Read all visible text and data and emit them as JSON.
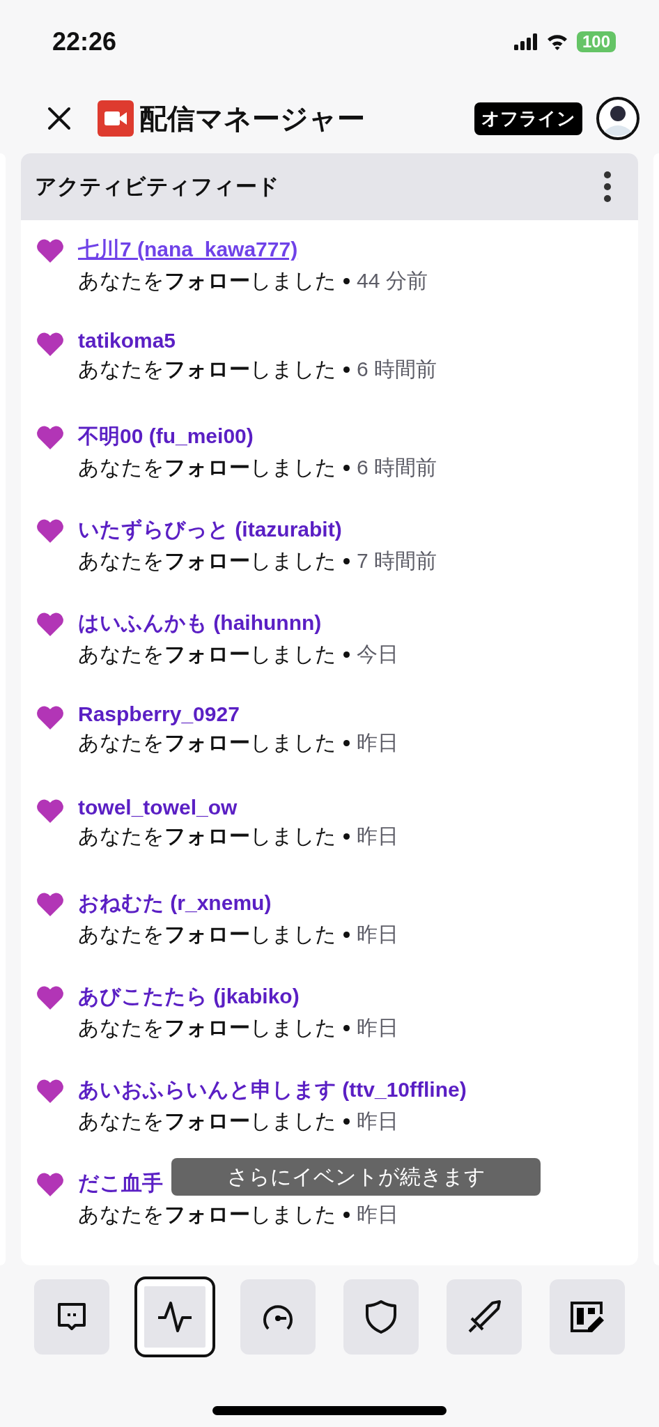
{
  "status_bar": {
    "time": "22:26",
    "battery": "100"
  },
  "header": {
    "title": "配信マネージャー",
    "status_badge": "オフライン"
  },
  "feed": {
    "title": "アクティビティフィード",
    "events": [
      {
        "name": "七川7 (nana_kawa777)",
        "message": "あなたを**フォロー**しました",
        "time": "44 分前",
        "highlighted": true
      },
      {
        "name": "tatikoma5",
        "message": "あなたを**フォロー**しました",
        "time": "6 時間前",
        "highlighted": false
      },
      {
        "name": "不明00 (fu_mei00)",
        "message": "あなたを**フォロー**しました",
        "time": "6 時間前",
        "highlighted": false
      },
      {
        "name": "いたずらびっと (itazurabit)",
        "message": "あなたを**フォロー**しました",
        "time": "7 時間前",
        "highlighted": false
      },
      {
        "name": "はいふんかも (haihunnn)",
        "message": "あなたを**フォロー**しました",
        "time": "今日",
        "highlighted": false
      },
      {
        "name": "Raspberry_0927",
        "message": "あなたを**フォロー**しました",
        "time": "昨日",
        "highlighted": false
      },
      {
        "name": "towel_towel_ow",
        "message": "あなたを**フォロー**しました",
        "time": "昨日",
        "highlighted": false
      },
      {
        "name": "おねむた (r_xnemu)",
        "message": "あなたを**フォロー**しました",
        "time": "昨日",
        "highlighted": false
      },
      {
        "name": "あびこたたら (jkabiko)",
        "message": "あなたを**フォロー**しました",
        "time": "昨日",
        "highlighted": false
      },
      {
        "name": "あいおふらいんと申します (ttv_10ffline)",
        "message": "あなたを**フォロー**しました",
        "time": "昨日",
        "highlighted": false
      },
      {
        "name": "だこ血手",
        "message": "あなたを**フォロー**しました",
        "time": "昨日",
        "highlighted": false
      }
    ],
    "toast": "さらにイベントが続きます"
  },
  "bottom_tabs": [
    {
      "selected": false
    },
    {
      "selected": true
    },
    {
      "selected": false
    },
    {
      "selected": false
    },
    {
      "selected": false
    },
    {
      "selected": false
    }
  ]
}
